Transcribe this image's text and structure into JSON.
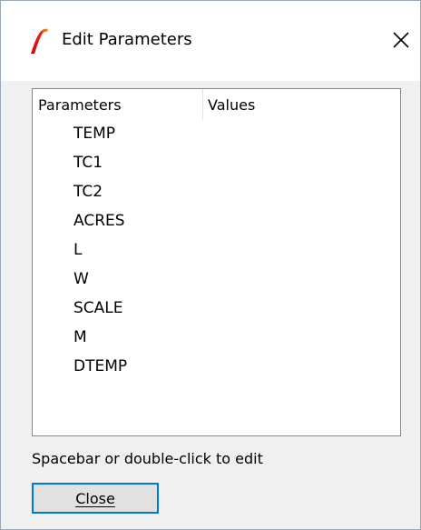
{
  "window": {
    "title": "Edit Parameters"
  },
  "icons": {
    "app": "simetrix-logo-icon",
    "close": "close-icon"
  },
  "colors": {
    "app_icon": "#e8251c",
    "app_icon_accent": "#f5a623",
    "button_focus_border": "#0078d7"
  },
  "list": {
    "columns": [
      "Parameters",
      "Values"
    ],
    "rows": [
      {
        "name": "TEMP",
        "value": ""
      },
      {
        "name": "TC1",
        "value": ""
      },
      {
        "name": "TC2",
        "value": ""
      },
      {
        "name": "ACRES",
        "value": ""
      },
      {
        "name": "L",
        "value": ""
      },
      {
        "name": "W",
        "value": ""
      },
      {
        "name": "SCALE",
        "value": ""
      },
      {
        "name": "M",
        "value": ""
      },
      {
        "name": "DTEMP",
        "value": ""
      }
    ]
  },
  "hint": "Spacebar or double-click to edit",
  "buttons": {
    "close_label": "Close"
  }
}
